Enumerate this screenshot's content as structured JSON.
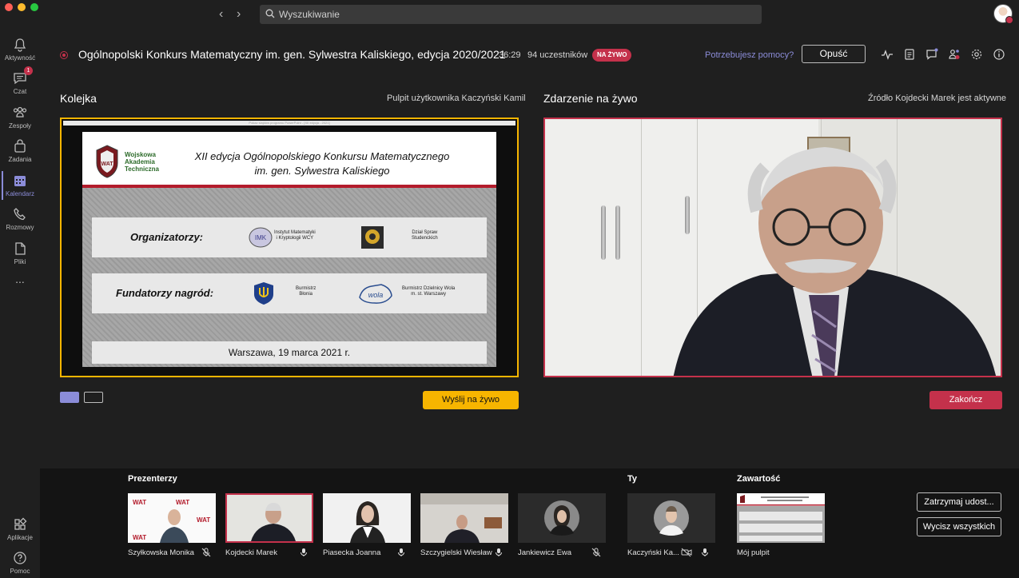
{
  "search": {
    "placeholder": "Wyszukiwanie"
  },
  "rail": {
    "items": [
      {
        "label": "Aktywność",
        "icon": "bell-icon"
      },
      {
        "label": "Czat",
        "icon": "chat-icon",
        "badge": "1"
      },
      {
        "label": "Zespoły",
        "icon": "teams-icon"
      },
      {
        "label": "Zadania",
        "icon": "assignments-icon"
      },
      {
        "label": "Kalendarz",
        "icon": "calendar-icon",
        "active": true
      },
      {
        "label": "Rozmowy",
        "icon": "phone-icon"
      },
      {
        "label": "Pliki",
        "icon": "file-icon"
      },
      {
        "label": "...",
        "icon": "more-icon"
      }
    ],
    "bottom": [
      {
        "label": "Aplikacje",
        "icon": "apps-icon"
      },
      {
        "label": "Pomoc",
        "icon": "help-icon"
      }
    ]
  },
  "meeting": {
    "title": "Ogólnopolski Konkurs Matematyczny im. gen. Sylwestra Kaliskiego, edycja 2020/2021",
    "elapsed": "36:29",
    "participants": "94 uczestników",
    "live_badge": "NA ŻYWO",
    "help_link": "Potrzebujesz pomocy?",
    "leave_label": "Opuść"
  },
  "queue": {
    "title": "Kolejka",
    "source": "Pulpit użytkownika Kaczyński Kamil",
    "send_label": "Wyślij na żywo"
  },
  "slide": {
    "header": "Pokaz slajdów programu PowerPoint - [XII edycja - 2021]",
    "logo_text": [
      "Wojskowa",
      "Akademia",
      "Techniczna"
    ],
    "title_line1": "XII edycja Ogólnopolskiego Konkursu Matematycznego",
    "title_line2": "im. gen. Sylwestra Kaliskiego",
    "organizers_heading": "Organizatorzy:",
    "org1": [
      "Instytut Matematyki",
      "i Kryptologii WCY"
    ],
    "org2": [
      "Dział Spraw",
      "Studenckich"
    ],
    "founders_heading": "Fundatorzy nagród:",
    "f1": [
      "Burmistrz",
      "Błonia"
    ],
    "f2": [
      "Burmistrz Dzielnicy Wola",
      "m. st. Warszawy"
    ],
    "footer": "Warszawa, 19 marca 2021 r."
  },
  "live": {
    "title": "Zdarzenie na żywo",
    "source": "Źródło Kojdecki Marek jest aktywne",
    "end_label": "Zakończ"
  },
  "presenters": {
    "label": "Prezenterzy",
    "people": [
      {
        "name": "Szyłkowska Monika",
        "mic": "mic-off-icon"
      },
      {
        "name": "Kojdecki Marek",
        "mic": "mic-icon"
      },
      {
        "name": "Piasecka Joanna",
        "mic": "mic-icon"
      },
      {
        "name": "Szczygielski Wiesław",
        "mic": "mic-icon"
      },
      {
        "name": "Jankiewicz Ewa",
        "mic": "mic-off-icon"
      }
    ]
  },
  "you": {
    "label": "Ty",
    "name": "Kaczyński Ka..."
  },
  "content": {
    "label": "Zawartość",
    "name": "Mój pulpit"
  },
  "actions": {
    "stop_sharing": "Zatrzymaj udost...",
    "mute_all": "Wycisz wszystkich"
  },
  "colors": {
    "accent": "#8b8cd8",
    "live": "#c4314b",
    "queue": "#f7b500",
    "background": "#1f1f1f"
  }
}
